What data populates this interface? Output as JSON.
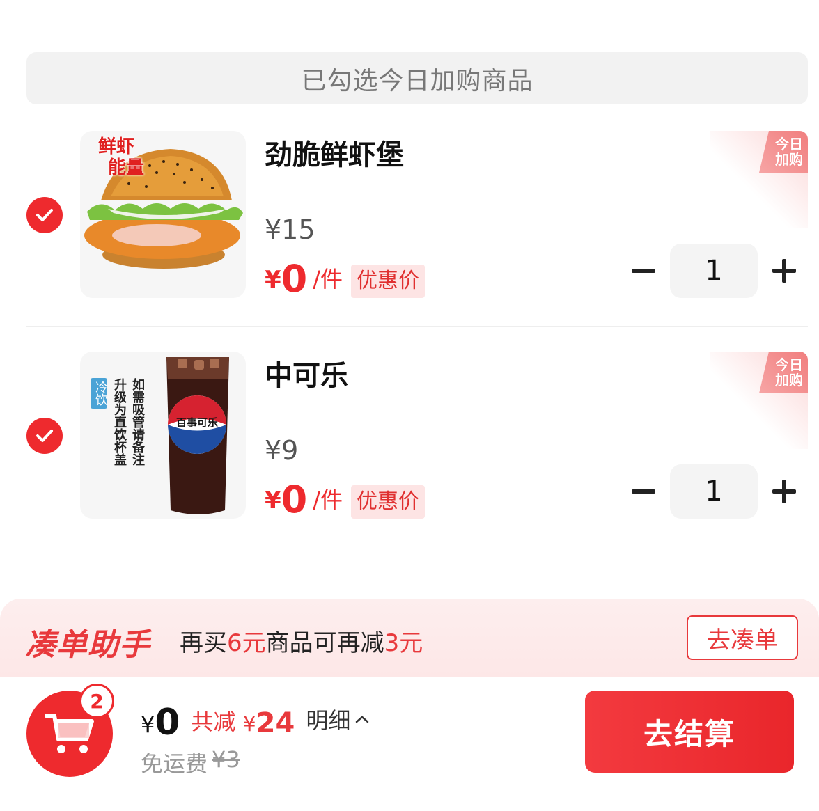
{
  "banner": {
    "text": "已勾选今日加购商品"
  },
  "items": [
    {
      "name": "劲脆鲜虾堡",
      "original_price": "¥15",
      "deal_currency": "¥",
      "deal_price": "0",
      "per_unit": "/件",
      "tag": "优惠价",
      "corner_label_line1": "今日",
      "corner_label_line2": "加购",
      "quantity": "1",
      "image_badge_line1": "鲜虾",
      "image_badge_line2": "能量",
      "icon": "shrimp-burger-image"
    },
    {
      "name": "中可乐",
      "original_price": "¥9",
      "deal_currency": "¥",
      "deal_price": "0",
      "per_unit": "/件",
      "tag": "优惠价",
      "corner_label_line1": "今日",
      "corner_label_line2": "加购",
      "quantity": "1",
      "image_badge": "冷饮",
      "image_note_col1": "升级为直饮杯盖",
      "image_note_col2": "如需吸管请备注",
      "cup_logo_text": "百事可乐",
      "icon": "cola-cup-image"
    }
  ],
  "helper": {
    "title": "凑单助手",
    "msg_prefix": "再买",
    "msg_amount": "6元",
    "msg_middle": "商品可再减",
    "msg_discount": "3元",
    "button": "去凑单"
  },
  "footer": {
    "cart_count": "2",
    "total_currency": "¥",
    "total_value": "0",
    "saved_label": "共减",
    "saved_currency": "¥",
    "saved_value": "24",
    "detail_label": "明细",
    "freight_label": "免运费",
    "freight_original": "¥3",
    "checkout_label": "去结算"
  },
  "colors": {
    "accent": "#ee2a2e",
    "tag_bg": "#fde4e4",
    "helper_bg": "#fdeeee"
  }
}
